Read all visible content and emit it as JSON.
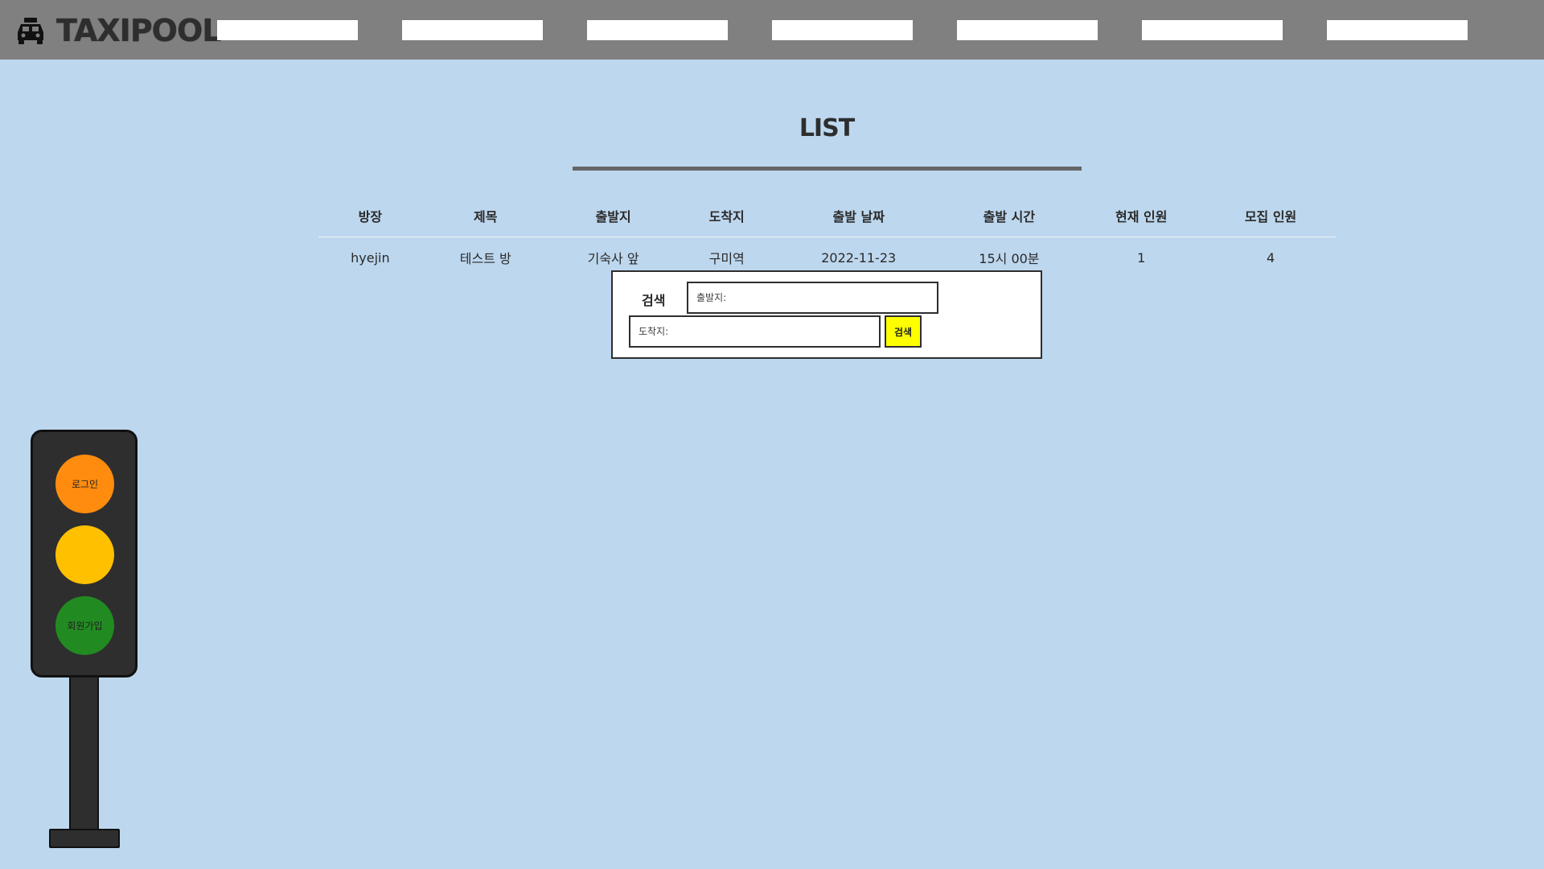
{
  "header": {
    "brand_name": "TAXIPOOL",
    "brand_icon": "taxi-icon",
    "nav_slots": 7
  },
  "page": {
    "title": "LIST"
  },
  "table": {
    "columns": [
      "방장",
      "제목",
      "출발지",
      "도착지",
      "출발 날짜",
      "출발 시간",
      "현재 인원",
      "모집 인원"
    ],
    "rows": [
      [
        "hyejin",
        "테스트 방",
        "기숙사 앞",
        "구미역",
        "2022-11-23",
        "15시 00분",
        "1",
        "4"
      ]
    ]
  },
  "search": {
    "label": "검색",
    "start_placeholder": "출발지:",
    "end_placeholder": "도착지:",
    "button_label": "검색"
  },
  "traffic_light": {
    "login_label": "로그인",
    "signup_label": "회원가입"
  },
  "colors": {
    "topbar": "#808080",
    "background": "#bdd7ee",
    "search_button": "#ffff00",
    "light_orange": "#ff8c0f",
    "light_yellow": "#ffc000",
    "light_green": "#218b21"
  }
}
